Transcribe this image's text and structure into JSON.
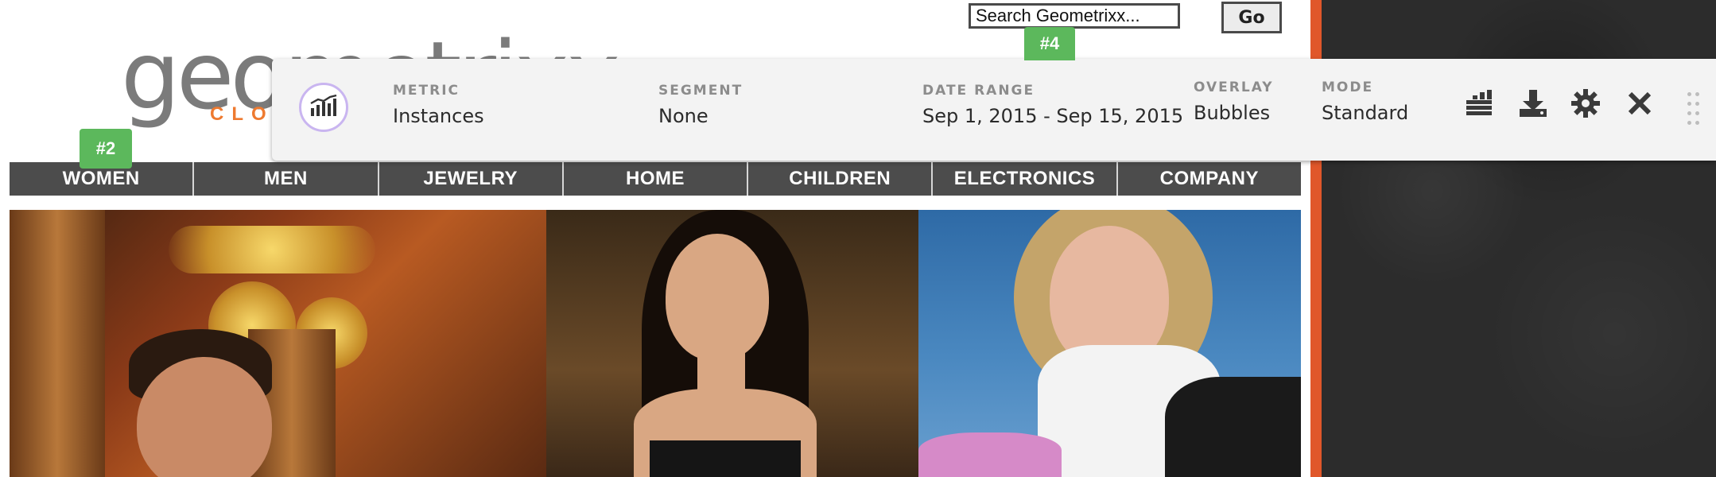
{
  "site": {
    "logo_text": "geometrixx",
    "logo_subtext": "CLOTHING",
    "search": {
      "value": "Search Geometrixx...",
      "button": "Go"
    },
    "nav": [
      "WOMEN",
      "MEN",
      "JEWELRY",
      "HOME",
      "CHILDREN",
      "ELECTRONICS",
      "COMPANY"
    ]
  },
  "toolbar": {
    "metric": {
      "label": "METRIC",
      "value": "Instances"
    },
    "segment": {
      "label": "SEGMENT",
      "value": "None"
    },
    "date_range": {
      "label": "DATE RANGE",
      "value": "Sep 1, 2015 - Sep 15, 2015"
    },
    "overlay": {
      "label": "OVERLAY",
      "value": "Bubbles"
    },
    "mode": {
      "label": "MODE",
      "value": "Standard"
    },
    "buttons": [
      "report-icon",
      "download-icon",
      "gear-icon",
      "close-icon"
    ]
  },
  "badges": [
    "#4",
    "#2"
  ],
  "colors": {
    "accent_orange": "#e0572a",
    "badge_green": "#5cb85c",
    "nav_bg": "#4c4c4c",
    "metric_ring": "#c9b5f0"
  }
}
